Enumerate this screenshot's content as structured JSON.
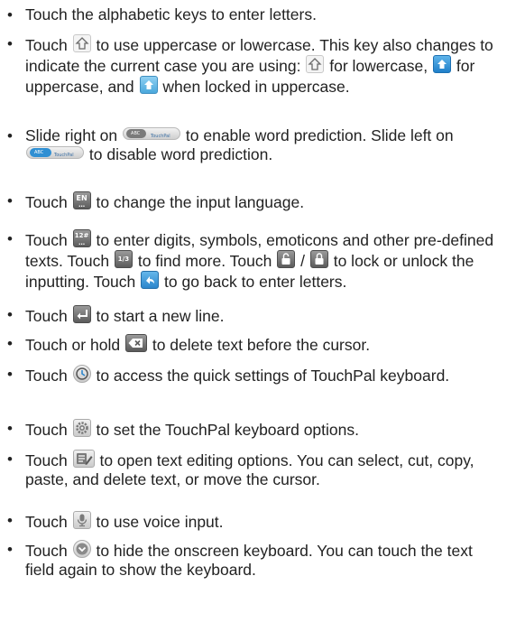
{
  "items": [
    {
      "before_icon": "Touch the alphabetic keys to enter letters."
    },
    {
      "before_icon": "Touch",
      "icon": "shift-key-icon",
      "after_icon": "to use uppercase or lowercase. This key also changes to indicate the current case you are using:",
      "lowercase_text": "for lowercase,",
      "uppercase_text": "for uppercase, and",
      "locked_text": "when locked in uppercase."
    },
    {
      "before_icon": "Slide right on",
      "after_icon": "to enable word prediction. Slide left on",
      "end_text": "to disable word prediction.",
      "toggle_off_label": "TouchPal",
      "toggle_on_label": "TouchPal",
      "toggle_knob_label": "ABC"
    },
    {
      "before_icon": "Touch",
      "icon_label": "EN",
      "after_icon": "to change the input language."
    },
    {
      "before_icon": "Touch",
      "icon_label": "12#",
      "after_icon": "to enter digits, symbols, emoticons and other pre-defined texts. Touch",
      "page_label": "1/3",
      "more_text": "to find more. Touch",
      "slash": "/",
      "lock_text": "to lock or unlock the inputting. Touch",
      "back_text": "to go back to enter letters."
    },
    {
      "before_icon": "Touch",
      "after_icon": "to start a new line."
    },
    {
      "before_icon": "Touch or hold",
      "after_icon": "to delete text before the cursor."
    },
    {
      "before_icon": "Touch",
      "after_icon": "to access the quick settings of TouchPal keyboard."
    },
    {
      "before_icon": "Touch",
      "after_icon": "to set the TouchPal keyboard options."
    },
    {
      "before_icon": "Touch",
      "after_icon": "to open text editing options. You can select, cut, copy, paste, and delete text, or move the cursor."
    },
    {
      "before_icon": "Touch",
      "after_icon": "to use voice input."
    },
    {
      "before_icon": "Touch",
      "after_icon": "to hide the onscreen keyboard. You can touch the text field again to show the keyboard."
    }
  ],
  "colors": {
    "text": "#222222",
    "accent_blue": "#2c86cc",
    "key_grey": "#5b5b5b"
  }
}
